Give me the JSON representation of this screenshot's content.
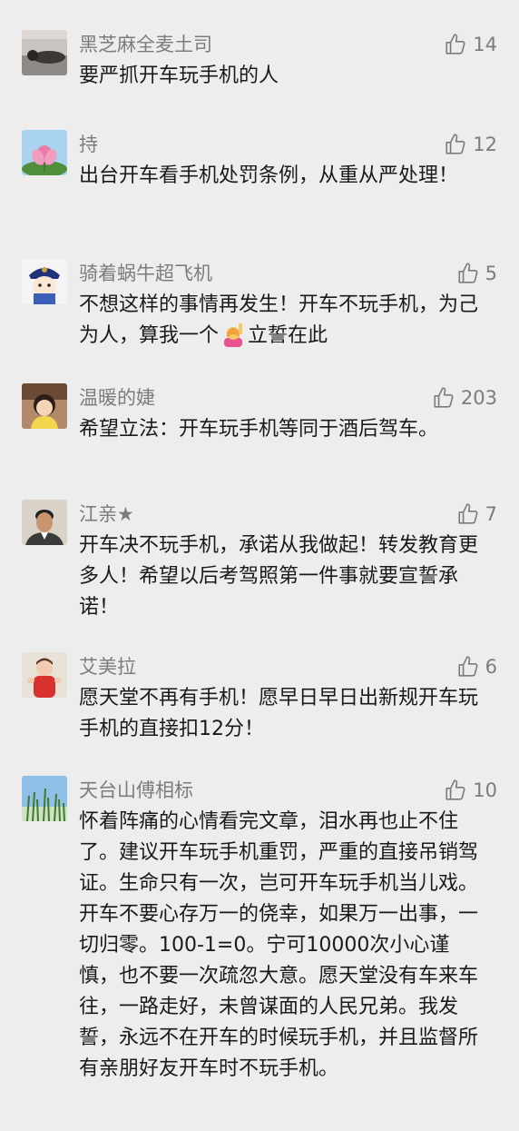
{
  "comments": [
    {
      "user": "黑芝麻全麦土司",
      "likes": "14",
      "text": "要严抓开车玩手机的人",
      "avatar_icon": "person-lying-avatar-icon"
    },
    {
      "user": "持",
      "likes": "12",
      "text": "出台开车看手机处罚条例，从重从严处理！",
      "avatar_icon": "lotus-avatar-icon"
    },
    {
      "user": "骑着蜗牛超飞机",
      "likes": "5",
      "text_before": "不想这样的事情再发生！开车不玩手机，为己为人，算我一个",
      "text_after": "立誓在此",
      "emoji": "person-raising-hand-emoji",
      "avatar_icon": "cartoon-character-avatar-icon"
    },
    {
      "user": "温暖的婕",
      "likes": "203",
      "text": "希望立法：开车玩手机等同于酒后驾车。",
      "avatar_icon": "child-avatar-icon"
    },
    {
      "user": "江亲★",
      "likes": "7",
      "text": "开车决不玩手机，承诺从我做起！转发教育更多人！希望以后考驾照第一件事就要宣誓承诺！",
      "avatar_icon": "man-portrait-avatar-icon"
    },
    {
      "user": "艾美拉",
      "likes": "6",
      "text": "愿天堂不再有手机！愿早日早日出新规开车玩手机的直接扣12分！",
      "avatar_icon": "toddler-red-avatar-icon"
    },
    {
      "user": "天台山傅相标",
      "likes": "10",
      "text": "怀着阵痛的心情看完文章，泪水再也止不住了。建议开车玩手机重罚，严重的直接吊销驾证。生命只有一次，岂可开车玩手机当儿戏。开车不要心存万一的侥幸，如果万一出事，一切归零。100-1=0。宁可10000次小心谨慎，也不要一次疏忽大意。愿天堂没有车来车往，一路走好，未曾谋面的人民兄弟。我发誓，永远不在开车的时候玩手机，并且监督所有亲朋好友开车时不玩手机。",
      "avatar_icon": "grass-sky-avatar-icon"
    }
  ]
}
